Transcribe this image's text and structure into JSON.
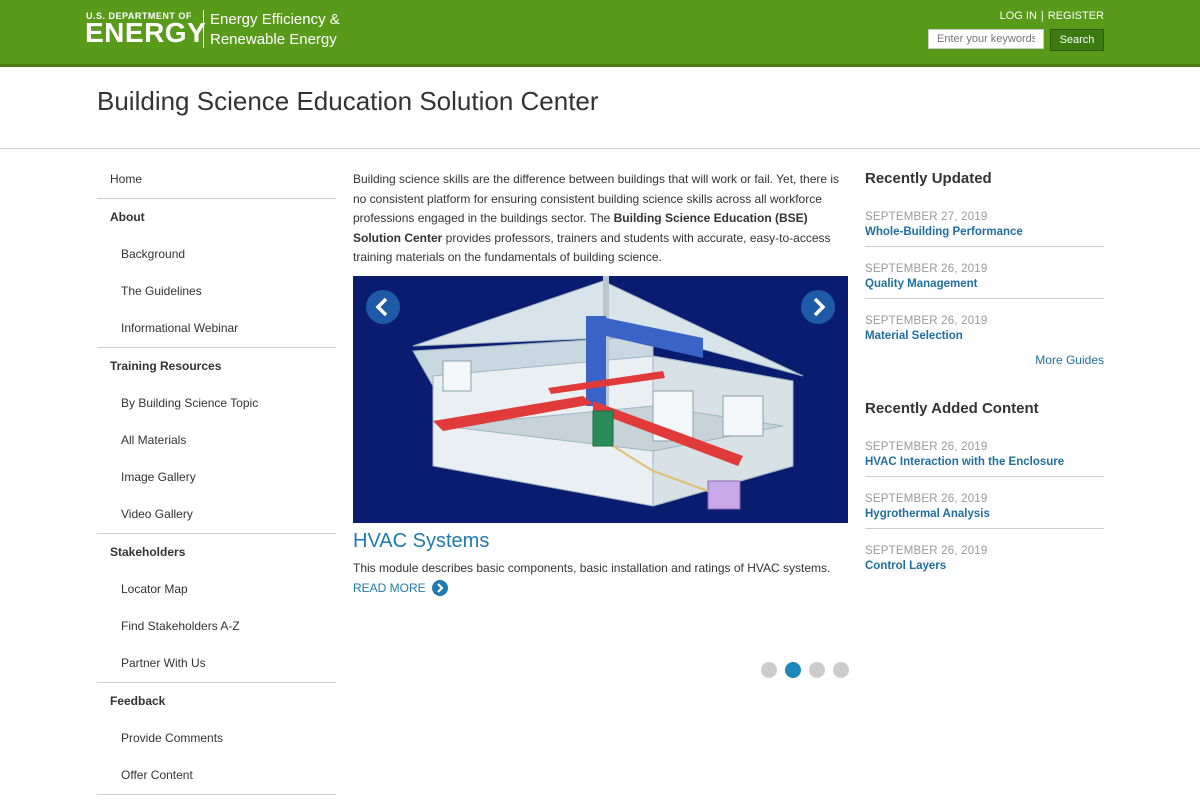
{
  "header": {
    "department": "U.S. DEPARTMENT OF",
    "logo_text": "ENERGY",
    "office_line1": "Energy Efficiency &",
    "office_line2": "Renewable Energy",
    "login_label": "LOG IN",
    "separator": "|",
    "register_label": "REGISTER",
    "search_placeholder": "Enter your keywords",
    "search_button": "Search"
  },
  "site_title": "Building Science Education Solution Center",
  "sidebar": {
    "items": [
      {
        "label": "Home"
      },
      {
        "label": "About"
      },
      {
        "label": "Background"
      },
      {
        "label": "The Guidelines"
      },
      {
        "label": "Informational Webinar"
      },
      {
        "label": "Training Resources"
      },
      {
        "label": "By Building Science Topic"
      },
      {
        "label": "All Materials"
      },
      {
        "label": "Image Gallery"
      },
      {
        "label": "Video Gallery"
      },
      {
        "label": "Stakeholders"
      },
      {
        "label": "Locator Map"
      },
      {
        "label": "Find Stakeholders A-Z"
      },
      {
        "label": "Partner With Us"
      },
      {
        "label": "Feedback"
      },
      {
        "label": "Provide Comments"
      },
      {
        "label": "Offer Content"
      }
    ]
  },
  "intro": {
    "part1": "Building science skills are the difference between buildings that will work or fail. Yet, there is no consistent platform for ensuring consistent building science skills across all workforce professions engaged in the buildings sector.  The ",
    "bold": "Building Science Education (BSE) Solution Center",
    "part2": " provides professors, trainers and students with accurate, easy-to-access training materials on the fundamentals of building science."
  },
  "slider": {
    "image_alt": "HVAC systems diagram",
    "title": "HVAC Systems",
    "description": "This module describes basic components, basic installation and ratings of HVAC systems.",
    "read_more": "READ MORE",
    "active_slide": 2,
    "total_slides": 4
  },
  "recently_updated": {
    "heading": "Recently Updated",
    "items": [
      {
        "date": "SEPTEMBER 27, 2019",
        "title": "Whole-Building Performance"
      },
      {
        "date": "SEPTEMBER 26, 2019",
        "title": "Quality Management"
      },
      {
        "date": "SEPTEMBER 26, 2019",
        "title": "Material Selection"
      }
    ],
    "more_label": "More Guides"
  },
  "recently_added": {
    "heading": "Recently Added Content",
    "items": [
      {
        "date": "SEPTEMBER 26, 2019",
        "title": "HVAC Interaction with the Enclosure"
      },
      {
        "date": "SEPTEMBER 26, 2019",
        "title": "Hygrothermal Analysis"
      },
      {
        "date": "SEPTEMBER 26, 2019",
        "title": "Control Layers"
      }
    ]
  },
  "colors": {
    "header_green": "#5a9a1a",
    "link_blue": "#1f6fa0",
    "slide_bg": "#0a1c70"
  }
}
